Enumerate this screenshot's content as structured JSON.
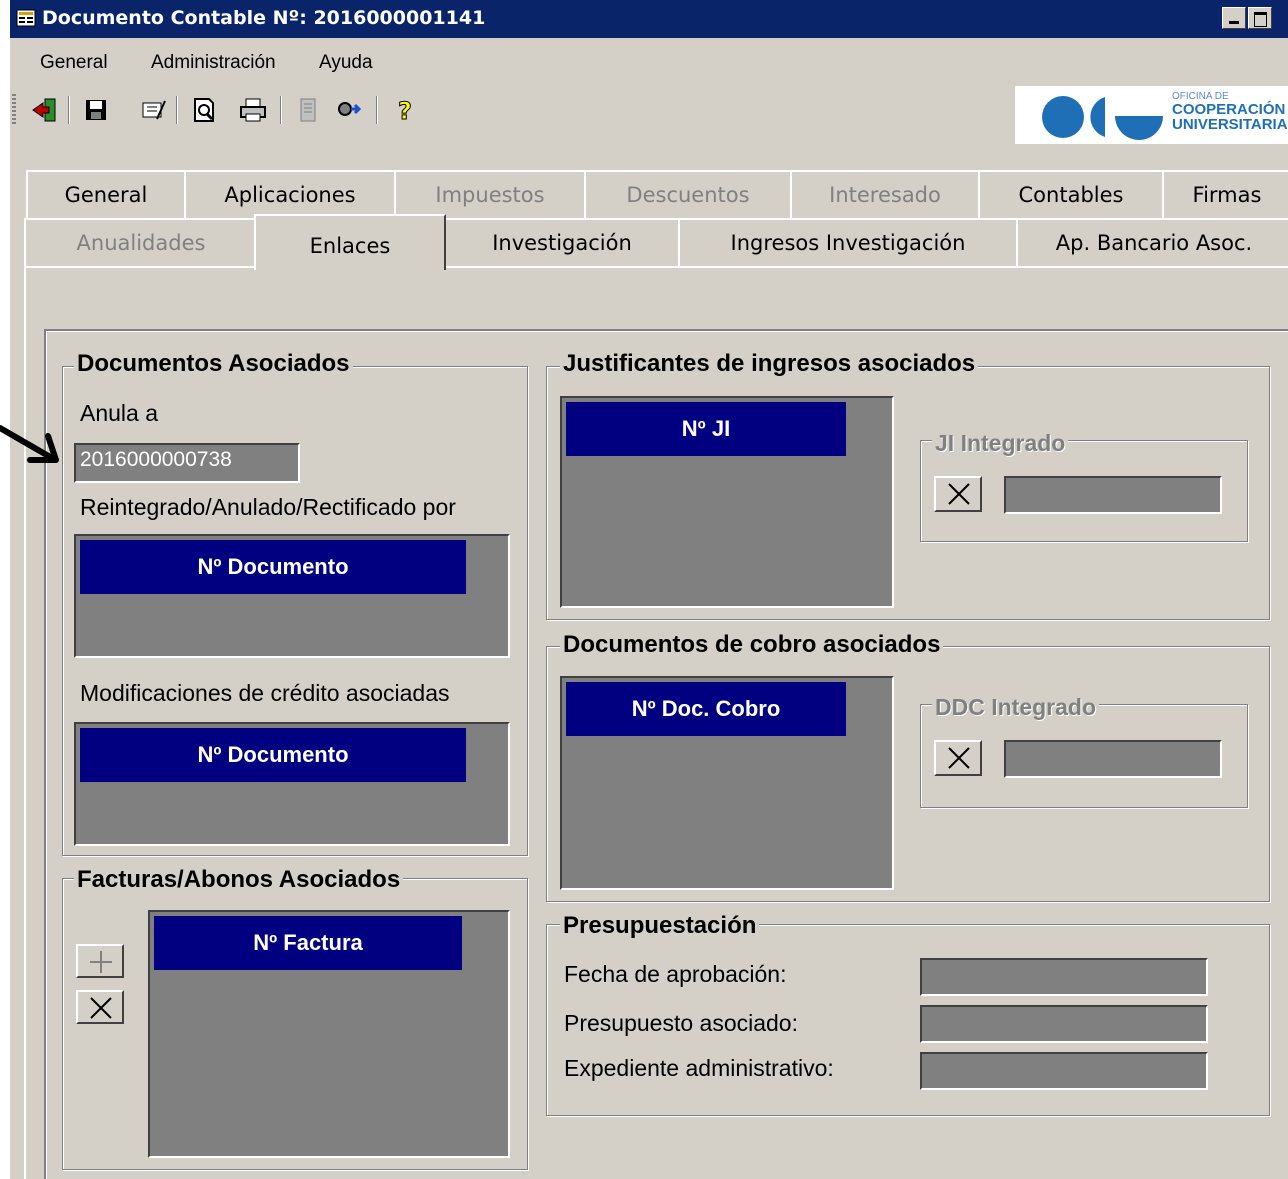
{
  "window": {
    "title": "Documento Contable Nº: 2016000001141"
  },
  "menu": {
    "items": [
      "General",
      "Administración",
      "Ayuda"
    ]
  },
  "toolbar": {
    "buttons": [
      "exit-icon",
      "save-icon",
      "edit-icon",
      "print-preview-icon",
      "print-icon",
      "document-icon",
      "search-icon",
      "help-icon"
    ]
  },
  "logo": {
    "line1": "OFICINA DE",
    "line2": "COOPERACIÓN",
    "line3": "UNIVERSITARIA"
  },
  "tabs": {
    "row1": [
      {
        "label": "General",
        "enabled": true
      },
      {
        "label": "Aplicaciones",
        "enabled": true
      },
      {
        "label": "Impuestos",
        "enabled": false
      },
      {
        "label": "Descuentos",
        "enabled": false
      },
      {
        "label": "Interesado",
        "enabled": false
      },
      {
        "label": "Contables",
        "enabled": true
      },
      {
        "label": "Firmas",
        "enabled": true
      }
    ],
    "row2": [
      {
        "label": "Anualidades",
        "enabled": false
      },
      {
        "label": "Enlaces",
        "enabled": true,
        "active": true
      },
      {
        "label": "Investigación",
        "enabled": true
      },
      {
        "label": "Ingresos Investigación",
        "enabled": true
      },
      {
        "label": "Ap. Bancario Asoc.",
        "enabled": true
      }
    ]
  },
  "documentos_asociados": {
    "title": "Documentos Asociados",
    "anula_label": "Anula a",
    "anula_value": "2016000000738",
    "reintegrado_label": "Reintegrado/Anulado/Rectificado por",
    "reintegrado_header": "Nº Documento",
    "modificaciones_label": "Modificaciones de crédito asociadas",
    "modificaciones_header": "Nº Documento"
  },
  "facturas": {
    "title": "Facturas/Abonos Asociados",
    "header": "Nº Factura"
  },
  "justificantes": {
    "title": "Justificantes de ingresos asociados",
    "header": "Nº JI",
    "integrado_label": "JI Integrado",
    "integrado_value": ""
  },
  "cobro": {
    "title": "Documentos de cobro asociados",
    "header": "Nº Doc. Cobro",
    "integrado_label": "DDC Integrado",
    "integrado_value": ""
  },
  "presupuestacion": {
    "title": "Presupuestación",
    "fecha_label": "Fecha de aprobación:",
    "fecha_value": "",
    "presupuesto_label": "Presupuesto asociado:",
    "presupuesto_value": "",
    "expediente_label": "Expediente administrativo:",
    "expediente_value": ""
  }
}
